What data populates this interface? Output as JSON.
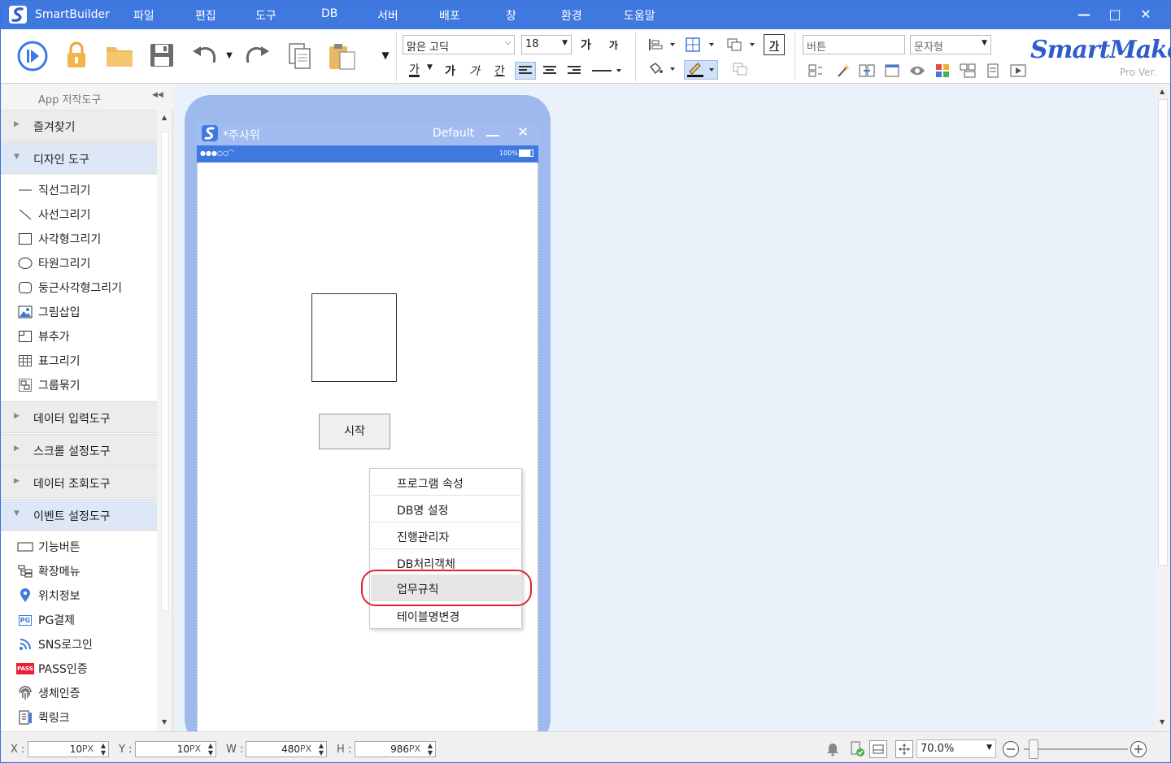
{
  "titlebar": {
    "app_name": "SmartBuilder",
    "menu": [
      "파일",
      "편집",
      "도구",
      "DB",
      "서버",
      "배포",
      "창",
      "환경",
      "도움말"
    ],
    "minimize": "—",
    "maximize": "□",
    "close": "✕"
  },
  "toolbar": {
    "font_family": "맑은 고딕",
    "font_size": "18",
    "grow_font": "가",
    "shrink_font": "가",
    "font_color": "가",
    "bold": "가",
    "italic": "가",
    "underline": "간",
    "control_name": "버튼",
    "control_type": "문자형",
    "fill_text": "가"
  },
  "brand": {
    "name": "SmartMaker",
    "version": "Pro Ver."
  },
  "sidebar": {
    "header": "App 저작도구",
    "sections": [
      {
        "label": "즐겨찾기"
      },
      {
        "label": "디자인 도구",
        "items": [
          "직선그리기",
          "사선그리기",
          "사각형그리기",
          "타원그리기",
          "둥근사각형그리기",
          "그림삽입",
          "뷰추가",
          "표그리기",
          "그룹묶기"
        ]
      },
      {
        "label": "데이터 입력도구"
      },
      {
        "label": "스크롤 설정도구"
      },
      {
        "label": "데이터 조회도구"
      },
      {
        "label": "이벤트 설정도구",
        "items": [
          "기능버튼",
          "확장메뉴",
          "위치정보",
          "PG결제",
          "SNS로그인",
          "PASS인증",
          "생체인증",
          "퀵링크"
        ]
      }
    ]
  },
  "form": {
    "title": "*주사위",
    "layout": "Default",
    "status_signal": "●●●○○",
    "status_battery": "100%",
    "start_button": "시작"
  },
  "context_menu": {
    "items": [
      "프로그램 속성",
      "DB명 설정",
      "진행관리자",
      "DB처리객체",
      "업무규칙",
      "테이블명변경"
    ],
    "highlighted": "업무규칙"
  },
  "icons": {
    "pg_badge": "PG",
    "pass_badge": "PASS"
  },
  "status": {
    "x_label": "X :",
    "x": "10",
    "y_label": "Y :",
    "y": "10",
    "w_label": "W :",
    "w": "480",
    "h_label": "H :",
    "h": "986",
    "unit": "PX",
    "zoom": "70.0%"
  }
}
